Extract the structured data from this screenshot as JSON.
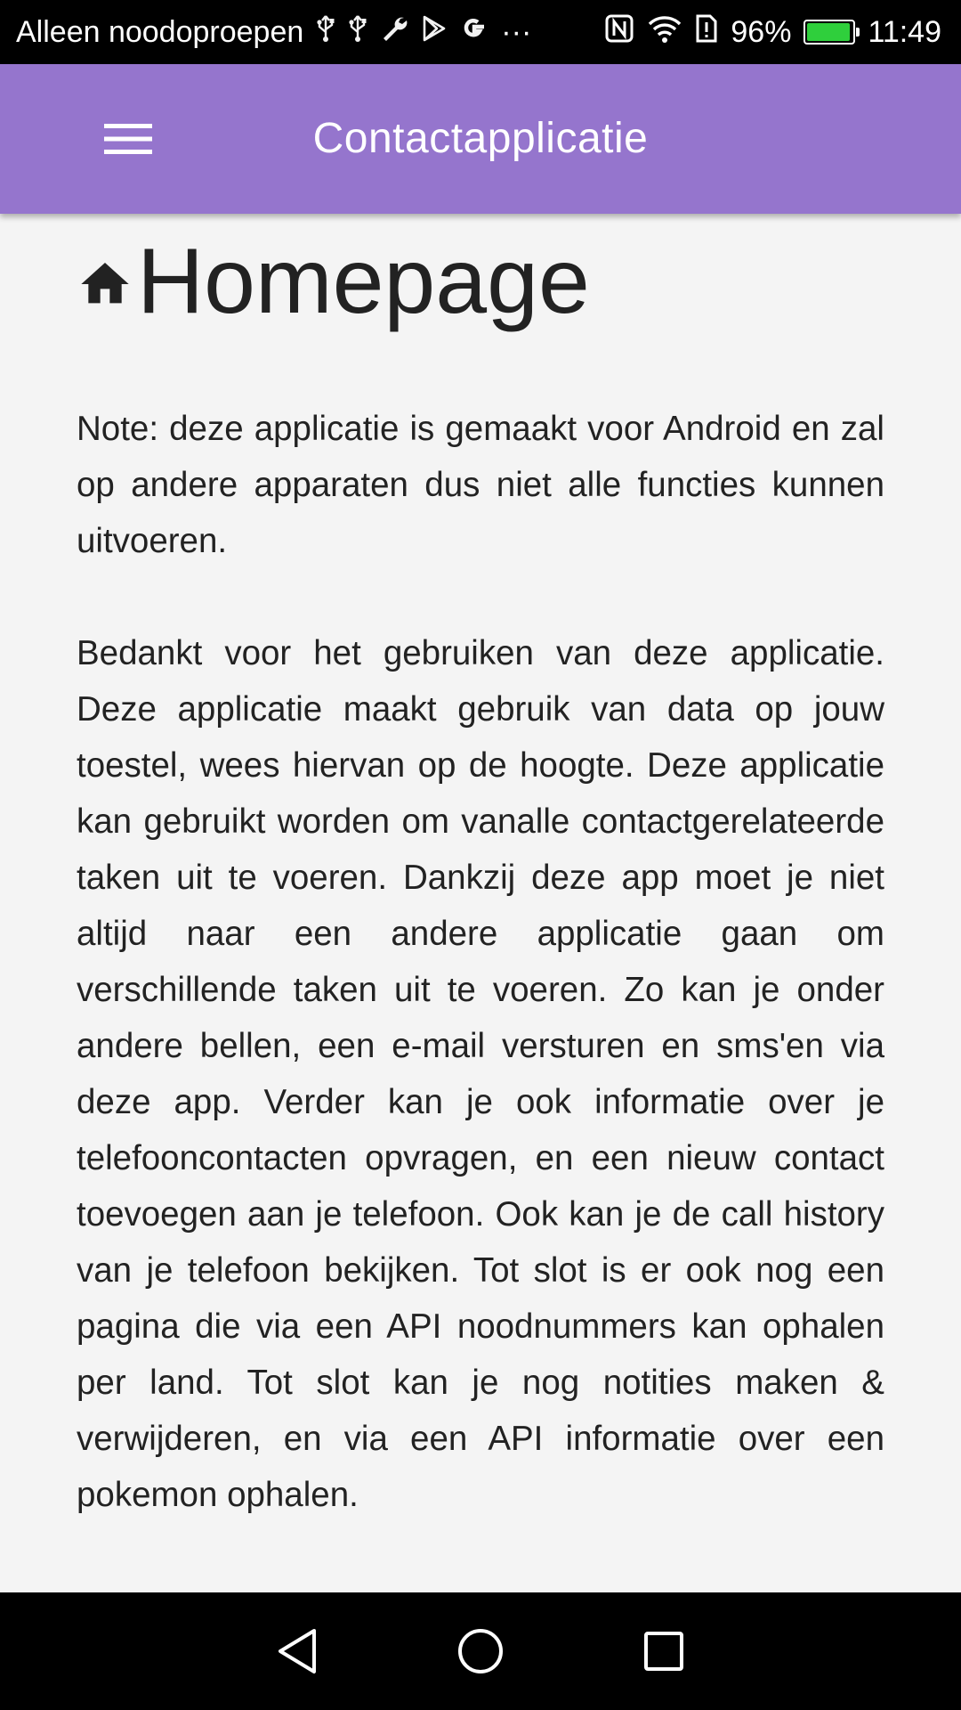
{
  "status_bar": {
    "carrier_text": "Alleen noodoproepen",
    "notification_icons": [
      "usb-icon",
      "usb-icon",
      "wrench-icon",
      "play-store-icon",
      "google-icon"
    ],
    "more_glyph": "···",
    "nfc_label": "N",
    "battery_percent": "96%",
    "battery_level": 0.96,
    "time": "11:49"
  },
  "app_bar": {
    "title": "Contactapplicatie",
    "menu_icon": "hamburger-menu-icon",
    "background_color": "#9575cd"
  },
  "page": {
    "title": "Homepage",
    "title_icon": "home-icon",
    "note": "Note: deze applicatie is gemaakt voor Android en zal op andere apparaten dus niet alle functies kunnen uitvoeren.",
    "body": "Bedankt voor het gebruiken van deze applicatie. Deze applicatie maakt gebruik van data op jouw toestel, wees hiervan op de hoogte. Deze applicatie kan gebruikt worden om vanalle contactgerelateerde taken uit te voeren. Dankzij deze app moet je niet altijd naar een andere applicatie gaan om verschillende taken uit te voeren. Zo kan je onder andere bellen, een e-mail versturen en sms'en via deze app. Verder kan je ook informatie over je telefooncontacten opvragen, en een nieuw contact toevoegen aan je telefoon. Ook kan je de call history van je telefoon bekijken. Tot slot is er ook nog een pagina die via een API noodnummers kan ophalen per land. Tot slot kan je nog notities maken & verwijderen, en via een API informatie over een pokemon ophalen."
  },
  "nav_bar": {
    "buttons": [
      "back-icon",
      "home-circle-icon",
      "recents-icon"
    ]
  }
}
